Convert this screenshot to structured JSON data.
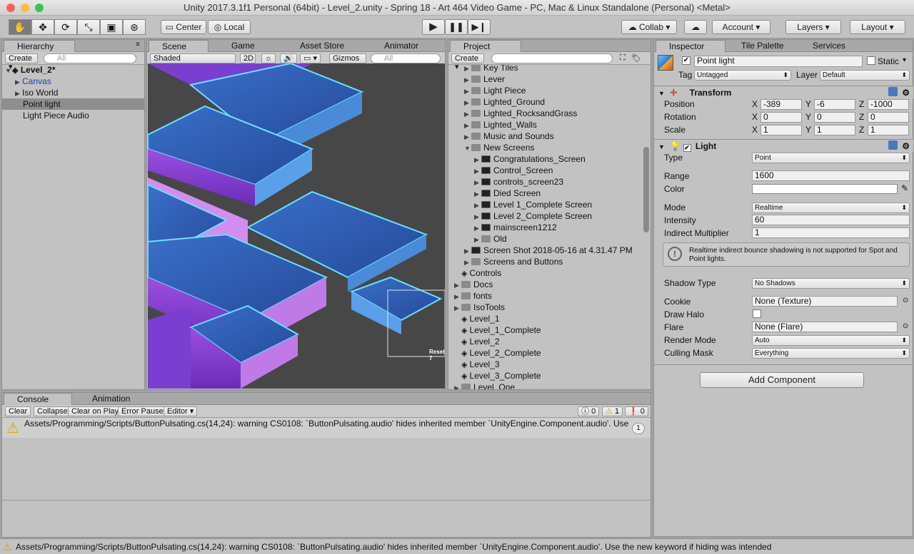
{
  "window": {
    "title": "Unity 2017.3.1f1 Personal (64bit) - Level_2.unity - Spring 18 - Art 464 Video Game - PC, Mac & Linux Standalone (Personal) <Metal>"
  },
  "toolbar": {
    "center_label": "Center",
    "local_label": "Local",
    "collab_label": "Collab",
    "account_label": "Account",
    "layers_label": "Layers",
    "layout_label": "Layout"
  },
  "hierarchy": {
    "tab": "Hierarchy",
    "create_label": "Create",
    "search_placeholder": "All",
    "scene_name": "Level_2*",
    "items": [
      "Canvas",
      "Iso World",
      "Point light",
      "Light Piece Audio"
    ]
  },
  "scene_view": {
    "tabs": [
      "Scene",
      "Game",
      "Asset Store",
      "Animator"
    ],
    "shading_mode": "Shaded",
    "mode_2d": "2D",
    "gizmos_label": "Gizmos",
    "search_placeholder": "All",
    "ui_text": "Reset: 7"
  },
  "project": {
    "tab": "Project",
    "create_label": "Create",
    "items": [
      {
        "label": "Key Tiles",
        "depth": 1,
        "kind": "folder"
      },
      {
        "label": "Lever",
        "depth": 1,
        "kind": "folder"
      },
      {
        "label": "Light Piece",
        "depth": 1,
        "kind": "folder"
      },
      {
        "label": "Lighted_Ground",
        "depth": 1,
        "kind": "folder"
      },
      {
        "label": "Lighted_RocksandGrass",
        "depth": 1,
        "kind": "folder"
      },
      {
        "label": "Lighted_Walls",
        "depth": 1,
        "kind": "folder"
      },
      {
        "label": "Music and Sounds",
        "depth": 1,
        "kind": "folder"
      },
      {
        "label": "New Screens",
        "depth": 1,
        "kind": "folder-open"
      },
      {
        "label": "Congratulations_Screen",
        "depth": 2,
        "kind": "image"
      },
      {
        "label": "Control_Screen",
        "depth": 2,
        "kind": "image"
      },
      {
        "label": "controls_screen23",
        "depth": 2,
        "kind": "image"
      },
      {
        "label": "Died Screen",
        "depth": 2,
        "kind": "image"
      },
      {
        "label": "Level 1_Complete Screen",
        "depth": 2,
        "kind": "image"
      },
      {
        "label": "Level 2_Complete Screen",
        "depth": 2,
        "kind": "image"
      },
      {
        "label": "mainscreen1212",
        "depth": 2,
        "kind": "image"
      },
      {
        "label": "Old",
        "depth": 2,
        "kind": "folder"
      },
      {
        "label": "Screen Shot 2018-05-16 at 4.31.47 PM",
        "depth": 1,
        "kind": "image"
      },
      {
        "label": "Screens and Buttons",
        "depth": 1,
        "kind": "folder"
      },
      {
        "label": "Controls",
        "depth": 0,
        "kind": "unity"
      },
      {
        "label": "Docs",
        "depth": 0,
        "kind": "folder"
      },
      {
        "label": "fonts",
        "depth": 0,
        "kind": "folder"
      },
      {
        "label": "IsoTools",
        "depth": 0,
        "kind": "folder"
      },
      {
        "label": "Level_1",
        "depth": 0,
        "kind": "unity"
      },
      {
        "label": "Level_1_Complete",
        "depth": 0,
        "kind": "unity"
      },
      {
        "label": "Level_2",
        "depth": 0,
        "kind": "unity"
      },
      {
        "label": "Level_2_Complete",
        "depth": 0,
        "kind": "unity"
      },
      {
        "label": "Level_3",
        "depth": 0,
        "kind": "unity"
      },
      {
        "label": "Level_3_Complete",
        "depth": 0,
        "kind": "unity"
      },
      {
        "label": "Level_One",
        "depth": 0,
        "kind": "folder"
      }
    ]
  },
  "inspector": {
    "tabs": [
      "Inspector",
      "Tile Palette",
      "Services"
    ],
    "object_name": "Point light",
    "static_label": "Static",
    "tag_label": "Tag",
    "tag_value": "Untagged",
    "layer_label": "Layer",
    "layer_value": "Default",
    "transform": {
      "title": "Transform",
      "position_label": "Position",
      "rotation_label": "Rotation",
      "scale_label": "Scale",
      "position": [
        "-389",
        "-6",
        "-1000"
      ],
      "rotation": [
        "0",
        "0",
        "0"
      ],
      "scale": [
        "1",
        "1",
        "1"
      ],
      "axis_x": "X",
      "axis_y": "Y",
      "axis_z": "Z"
    },
    "light": {
      "title": "Light",
      "type_label": "Type",
      "type_value": "Point",
      "range_label": "Range",
      "range_value": "1600",
      "color_label": "Color",
      "color_value": "#ffffff",
      "mode_label": "Mode",
      "mode_value": "Realtime",
      "intensity_label": "Intensity",
      "intensity_value": "60",
      "indirect_label": "Indirect Multiplier",
      "indirect_value": "1",
      "warning": "Realtime indirect bounce shadowing is not supported for Spot and Point lights.",
      "shadow_label": "Shadow Type",
      "shadow_value": "No Shadows",
      "cookie_label": "Cookie",
      "cookie_value": "None (Texture)",
      "halo_label": "Draw Halo",
      "flare_label": "Flare",
      "flare_value": "None (Flare)",
      "render_label": "Render Mode",
      "render_value": "Auto",
      "culling_label": "Culling Mask",
      "culling_value": "Everything"
    },
    "add_component": "Add Component"
  },
  "console": {
    "tabs": [
      "Console",
      "Animation"
    ],
    "buttons": [
      "Clear",
      "Collapse",
      "Clear on Play",
      "Error Pause",
      "Editor"
    ],
    "count_info": "0",
    "count_warn": "1",
    "count_err": "0",
    "message": "Assets/Programming/Scripts/ButtonPulsating.cs(14,24): warning CS0108: `ButtonPulsating.audio' hides inherited member `UnityEngine.Component.audio'. Use the",
    "message_count": "1"
  },
  "status": {
    "message": "Assets/Programming/Scripts/ButtonPulsating.cs(14,24): warning CS0108: `ButtonPulsating.audio' hides inherited member `UnityEngine.Component.audio'. Use the new keyword if hiding was intended"
  }
}
